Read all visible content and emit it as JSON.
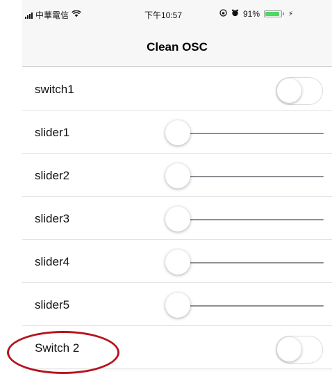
{
  "status_bar": {
    "carrier": "中華電信",
    "time": "下午10:57",
    "battery_text": "91%",
    "battery_level": 0.91,
    "icons": [
      "signal-icon",
      "wifi-icon",
      "orientation-lock-icon",
      "alarm-icon",
      "battery-icon",
      "charging-icon"
    ]
  },
  "nav": {
    "title": "Clean OSC"
  },
  "rows": [
    {
      "label": "switch1",
      "control": "toggle",
      "on": false
    },
    {
      "label": "slider1",
      "control": "slider",
      "value": 0
    },
    {
      "label": "slider2",
      "control": "slider",
      "value": 0
    },
    {
      "label": "slider3",
      "control": "slider",
      "value": 0
    },
    {
      "label": "slider4",
      "control": "slider",
      "value": 0
    },
    {
      "label": "slider5",
      "control": "slider",
      "value": 0
    },
    {
      "label": "Switch 2",
      "control": "toggle",
      "on": false,
      "annotated": true
    }
  ],
  "colors": {
    "annotation_ring": "#b5141c",
    "battery_fill": "#4cd964",
    "slider_track": "#8e8e93"
  }
}
